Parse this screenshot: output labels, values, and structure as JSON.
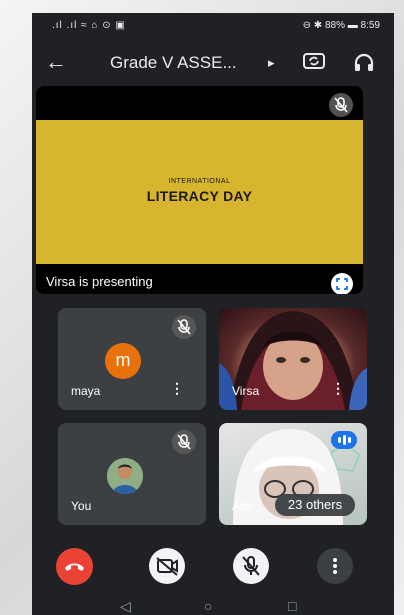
{
  "status_bar": {
    "left_icons": ".ıl .ıl ≈ ⌂ ⊙ ▣",
    "right_text": "⊖ ✱ 88% ▬ 8:59"
  },
  "header": {
    "back_icon": "back-arrow-icon",
    "title": "Grade V ASSE...",
    "more_icon": "triangle-right-icon",
    "camera_switch_icon": "switch-camera-icon",
    "audio_icon": "headphones-icon"
  },
  "presentation": {
    "slide_small_text": "INTERNATIONAL",
    "slide_big_text": "LITERACY DAY",
    "slide_color": "#d8b52e",
    "presenter_label": "Virsa is presenting"
  },
  "participants": [
    {
      "name": "maya",
      "avatar_letter": "m",
      "avatar_color": "#e8710a",
      "muted": true
    },
    {
      "name": "Virsa",
      "muted": false
    },
    {
      "name": "You",
      "muted": true
    },
    {
      "name": "Adri",
      "others_label": "23 others"
    }
  ],
  "controls": {
    "end_call_color": "#ea4335"
  },
  "nav": {
    "back": "◁",
    "home": "○",
    "recents": "□"
  }
}
